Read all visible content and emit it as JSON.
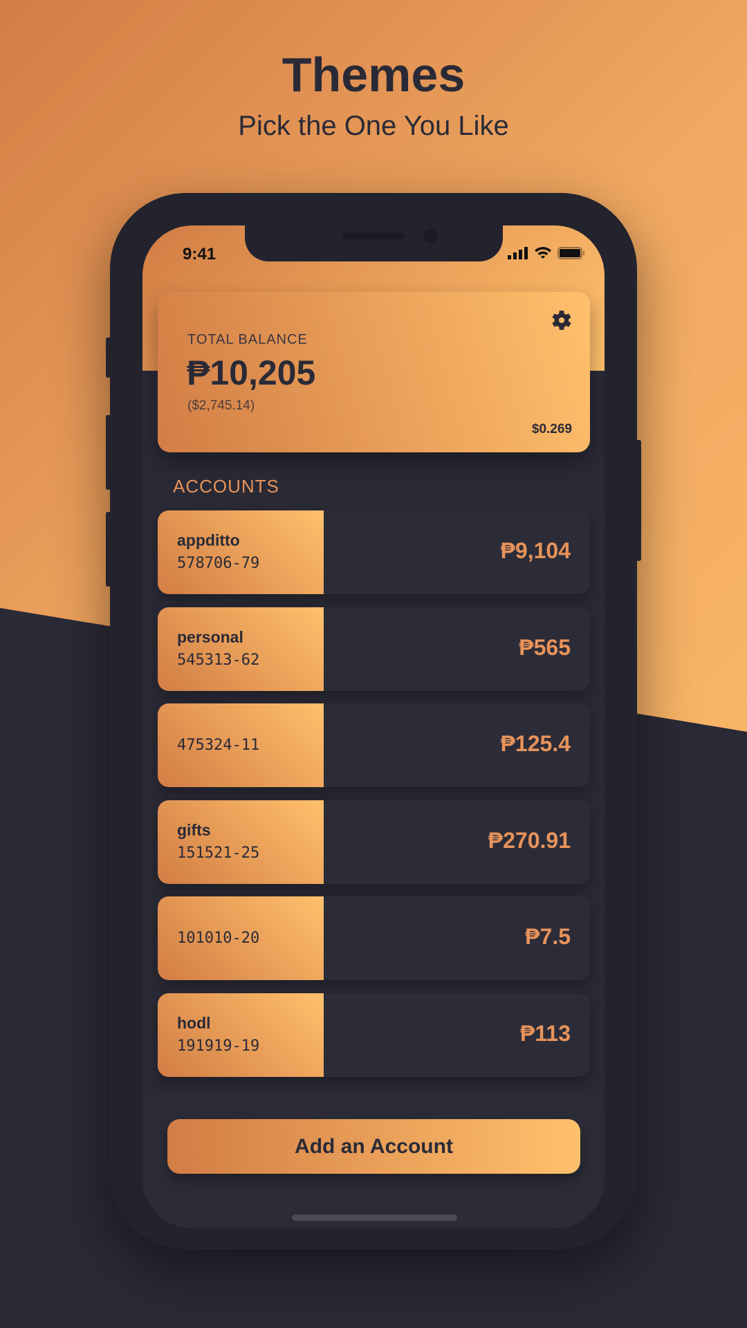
{
  "header": {
    "title": "Themes",
    "subtitle": "Pick the One You Like"
  },
  "status_bar": {
    "time": "9:41",
    "icons": [
      "signal-icon",
      "wifi-icon",
      "battery-icon"
    ]
  },
  "balance_card": {
    "label": "TOTAL BALANCE",
    "amount": "₱10,205",
    "usd": "($2,745.14)",
    "price": "$0.269",
    "settings_icon": "gear-icon"
  },
  "accounts": {
    "label": "ACCOUNTS",
    "items": [
      {
        "name": "appditto",
        "number": "578706-79",
        "amount": "₱9,104"
      },
      {
        "name": "personal",
        "number": "545313-62",
        "amount": "₱565"
      },
      {
        "name": "",
        "number": "475324-11",
        "amount": "₱125.4"
      },
      {
        "name": "gifts",
        "number": "151521-25",
        "amount": "₱270.91"
      },
      {
        "name": "",
        "number": "101010-20",
        "amount": "₱7.5"
      },
      {
        "name": "hodl",
        "number": "191919-19",
        "amount": "₱113"
      }
    ]
  },
  "add_button": {
    "label": "Add an Account"
  },
  "colors": {
    "accent": "#e8935a",
    "gradient_start": "#d27d45",
    "gradient_end": "#ffc06c",
    "dark": "#2a2a36"
  }
}
